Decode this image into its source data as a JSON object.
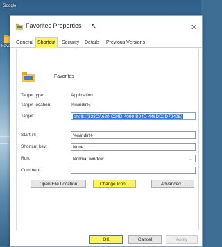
{
  "desktop": {
    "top_label": "Google",
    "side_label": "Favorit"
  },
  "dialog": {
    "title": "Favorites Properties",
    "close_glyph": "✕",
    "cursor_glyph": "↖",
    "tabs": [
      {
        "label": "General"
      },
      {
        "label": "Shortcut"
      },
      {
        "label": "Security"
      },
      {
        "label": "Details"
      },
      {
        "label": "Previous Versions"
      }
    ],
    "icon_name": "folder-star-icon",
    "item_name": "Favorites",
    "fields": {
      "target_type_label": "Target type:",
      "target_type_value": "Application",
      "target_location_label": "Target location:",
      "target_location_value": "%windir%",
      "target_label": "Target:",
      "target_value": "shell:::{323CA680-C24D-4099-B94D-446DD2D7249E}",
      "start_in_label": "Start in:",
      "start_in_value": "%windir%",
      "shortcut_key_label": "Shortcut key:",
      "shortcut_key_value": "None",
      "run_label": "Run:",
      "run_value": "Normal window",
      "comment_label": "Comment:",
      "comment_value": ""
    },
    "buttons": {
      "open_file_location": "Open File Location",
      "change_icon": "Change Icon...",
      "advanced": "Advanced...",
      "ok": "OK",
      "cancel": "Cancel",
      "apply": "Apply"
    },
    "colors": {
      "highlight": "#fff35a",
      "selection": "#2f7ad8"
    }
  }
}
